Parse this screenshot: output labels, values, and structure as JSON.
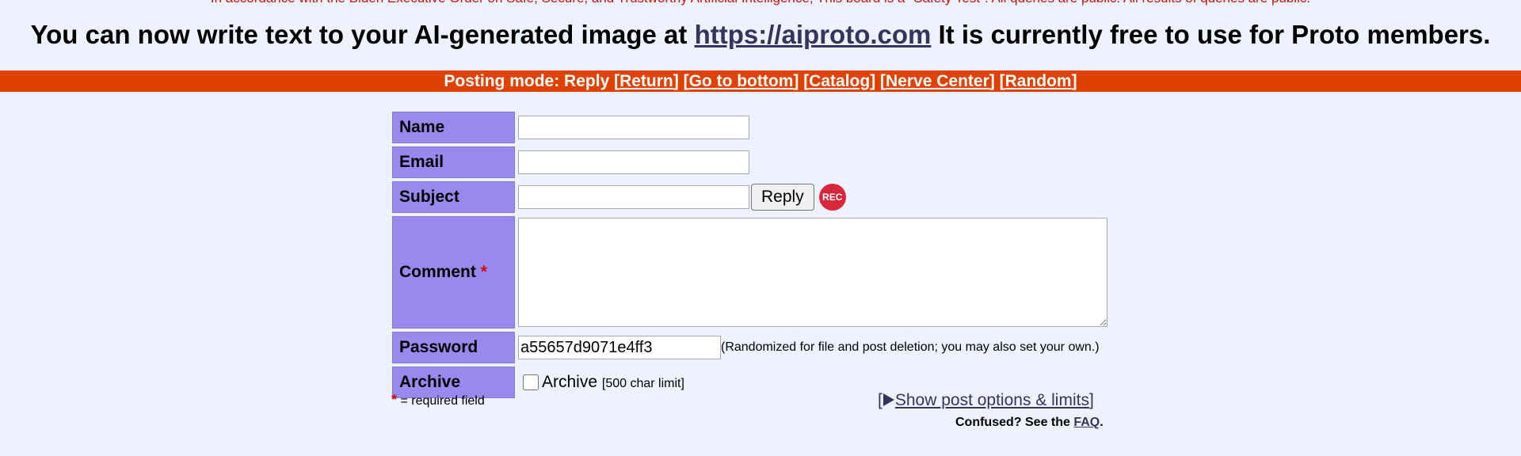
{
  "notice": {
    "text": "In accordance with the Biden Executive Order on Safe, Secure, and Trustworthy Artificial Intelligence, This board is a \"Safety Test\". All queries are public. All results of queries are public."
  },
  "announcement": {
    "prefix": "You can now write text to your AI-generated image at ",
    "link": "https://aiproto.com",
    "suffix": " It is currently free to use for Proto members."
  },
  "mode_bar": {
    "text": "Posting mode: Reply",
    "links": [
      "Return",
      "Go to bottom",
      "Catalog",
      "Nerve Center",
      "Random"
    ]
  },
  "form": {
    "name_label": "Name",
    "name_value": "",
    "email_label": "Email",
    "email_value": "",
    "subject_label": "Subject",
    "subject_value": "",
    "reply_button": "Reply",
    "rec_badge": "REC",
    "comment_label": "Comment",
    "comment_required_mark": "*",
    "comment_value": "",
    "password_label": "Password",
    "password_value": "a55657d9071e4ff3",
    "password_note": "(Randomized for file and post deletion; you may also set your own.)",
    "archive_label": "Archive",
    "archive_checkbox_label": "Archive",
    "archive_checked": false,
    "archive_limit": "[500 char limit]"
  },
  "footer": {
    "required_mark": "*",
    "required_note": "= required field",
    "show_options_open": "[",
    "show_options_icon": "play-triangle-icon",
    "show_options_label": "Show post options & limits",
    "show_options_close": "]",
    "confused_text": "Confused? See the ",
    "faq_link": "FAQ",
    "confused_end": "."
  }
}
